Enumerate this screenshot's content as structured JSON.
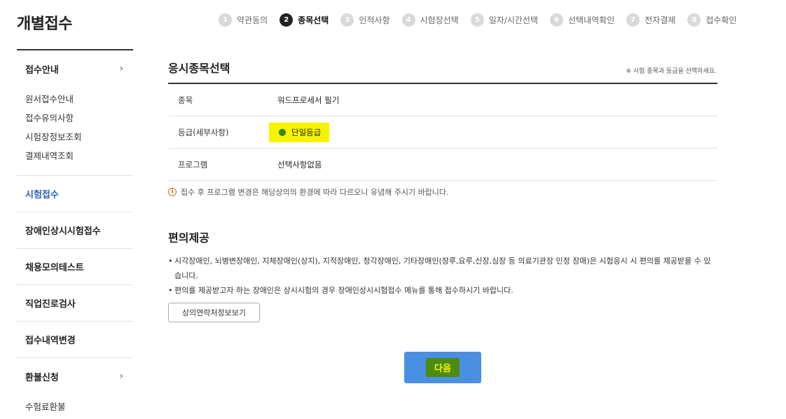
{
  "page_title": "개별접수",
  "steps": [
    {
      "num": "1",
      "label": "약관동의",
      "active": false
    },
    {
      "num": "2",
      "label": "종목선택",
      "active": true
    },
    {
      "num": "3",
      "label": "인적사항",
      "active": false
    },
    {
      "num": "4",
      "label": "시험장선택",
      "active": false
    },
    {
      "num": "5",
      "label": "일자/시간선택",
      "active": false
    },
    {
      "num": "6",
      "label": "선택내역확인",
      "active": false
    },
    {
      "num": "7",
      "label": "전자결제",
      "active": false
    },
    {
      "num": "8",
      "label": "접수확인",
      "active": false
    }
  ],
  "sidebar": {
    "guide": {
      "label": "접수안내",
      "chevron": "›",
      "sub": [
        "원서접수안내",
        "접수유의사항",
        "시험장정보조회",
        "결제내역조회"
      ]
    },
    "exam_apply": "시험접수",
    "disabled_apply": "장애인상시시험접수",
    "mock_test": "채용모의테스트",
    "career_test": "직업진로검사",
    "change": "접수내역변경",
    "refund": {
      "label": "환불신청",
      "chevron": "›",
      "sub": [
        "수험료환불"
      ]
    }
  },
  "exam_select": {
    "title": "응시종목선택",
    "note": "※ 시험 종목과 등급을 선택하세요.",
    "rows": {
      "subject_label": "종목",
      "subject_value": "워드프로세서 필기",
      "grade_label": "등급(세부사항)",
      "grade_value": "단일등급",
      "program_label": "프로그램",
      "program_value": "선택사항없음"
    },
    "warning_icon": "i",
    "warning": "접수 후 프로그램 변경은 해당상의의 환경에 따라 다르오니 유념해 주시기 바랍니다."
  },
  "convenience": {
    "title": "편의제공",
    "bullet_mark": "•",
    "bullet1": "시각장애인, 뇌병변장애인, 지체장애인(상지), 지적장애인, 청각장애인, 기타장애인(장루,요루,신장,심장 등 의료기관장 인정 장애)은 시험응시 시 편의를 제공받을 수 있습니다.",
    "bullet2": "편의를 제공받고자 하는 장애인은 상시시험의 경우 장애인상시시험접수 메뉴를 통해 접수하시기 바랍니다.",
    "contact_button": "상의연락처정보보기"
  },
  "next_button": "다음",
  "colors": {
    "accent": "#4a90e2",
    "highlight": "#f6f300",
    "active_menu": "#2d62b3",
    "radio": "#3a8a1e"
  }
}
